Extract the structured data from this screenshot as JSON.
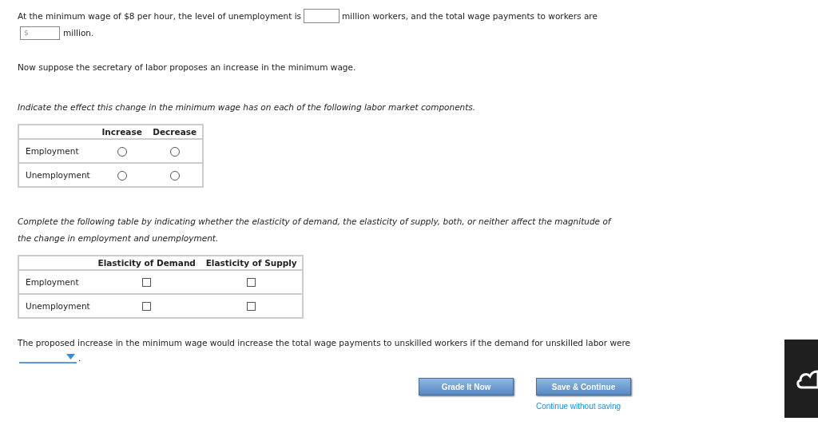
{
  "question_1": {
    "text_before": "At the minimum wage of $8 per hour, the level of unemployment is",
    "text_middle": "million workers, and the total wage payments to workers are",
    "payments_field": {
      "placeholder": "$"
    },
    "text_after": "million."
  },
  "scenario": "Now suppose the secretary of labor proposes an increase in the minimum wage.",
  "instruction_1": "Indicate the effect this change in the minimum wage has on each of the following labor market components.",
  "effect_table": {
    "columns": [
      "Increase",
      "Decrease"
    ],
    "rows": [
      {
        "label": "Employment",
        "options": [
          {
            "selected": false
          },
          {
            "selected": false
          }
        ]
      },
      {
        "label": "Unemployment",
        "options": [
          {
            "selected": false
          },
          {
            "selected": false
          }
        ]
      }
    ]
  },
  "instruction_2": "Complete the following table by indicating whether the elasticity of demand, the elasticity of supply, both, or neither affect the magnitude of the change in employment and unemployment.",
  "elasticity_table": {
    "columns": [
      "Elasticity of Demand",
      "Elasticity of Supply"
    ],
    "rows": [
      {
        "label": "Employment",
        "checks": [
          {
            "checked": false
          },
          {
            "checked": false
          }
        ]
      },
      {
        "label": "Unemployment",
        "checks": [
          {
            "checked": false
          },
          {
            "checked": false
          }
        ]
      }
    ]
  },
  "question_3": {
    "text": "The proposed increase in the minimum wage would increase the total wage payments to unskilled workers if the demand for unskilled labor were",
    "end": "."
  },
  "buttons": [
    "Grade It Now",
    "Save & Continue"
  ],
  "link": "Continue without saving"
}
